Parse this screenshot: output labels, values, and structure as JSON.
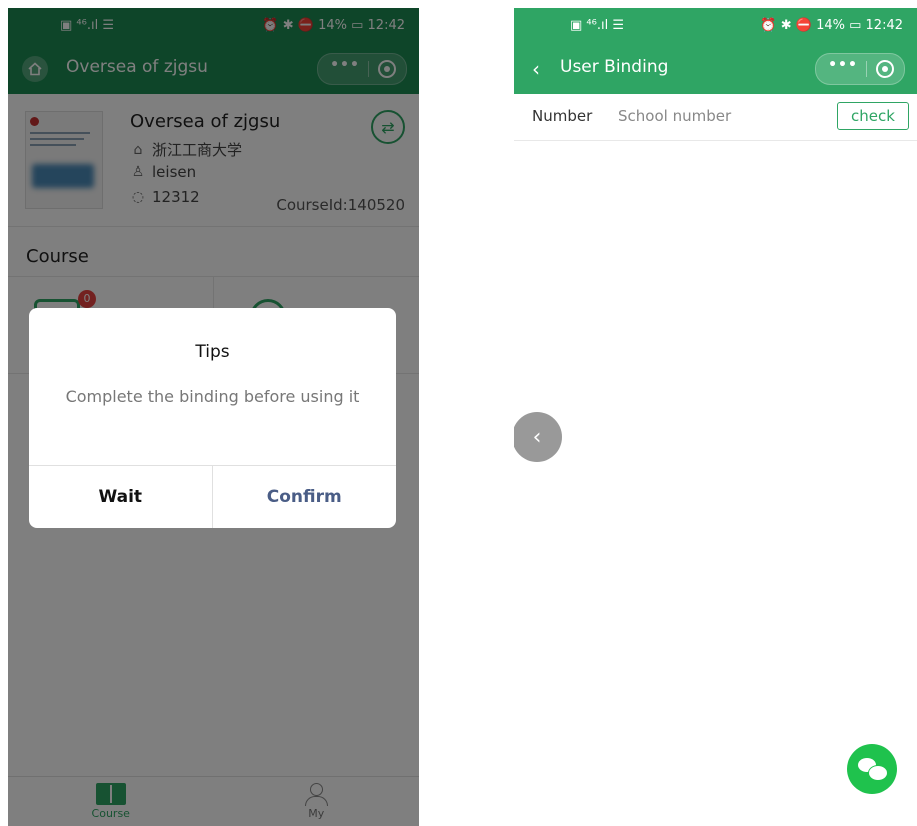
{
  "left": {
    "status": {
      "left": "▣ ⁴⁶.ıl ☰",
      "right": "⏰ ✱ ⛔ 14% ▭ 12:42"
    },
    "nav": {
      "title": "Oversea of zjgsu",
      "menu_dots": "•••"
    },
    "course_card": {
      "title": "Oversea of zjgsu",
      "school": "浙江工商大学",
      "teacher": "leisen",
      "number": "12312",
      "course_id": "CourseId:140520",
      "switch_glyph": "⇄"
    },
    "section_title": "Course",
    "grid": {
      "badge": "0"
    },
    "dialog": {
      "title": "Tips",
      "message": "Complete the binding before using it",
      "cancel_label": "Wait",
      "confirm_label": "Confirm"
    },
    "tabs": [
      {
        "label": "Course",
        "active": true
      },
      {
        "label": "My",
        "active": false
      }
    ]
  },
  "right": {
    "status": {
      "left": "▣ ⁴⁶.ıl ☰",
      "right": "⏰ ✱ ⛔ 14% ▭ 12:42"
    },
    "nav": {
      "title": "User Binding",
      "back": "‹",
      "menu_dots": "•••"
    },
    "form": {
      "label": "Number",
      "placeholder": "School number",
      "value": "",
      "check_label": "check"
    },
    "side_back": "‹"
  },
  "colors": {
    "primary": "#2fa564",
    "primary_dark": "#1d8a52",
    "badge": "#e64340",
    "confirm_text": "#4a5d86",
    "wechat": "#1fc24d"
  }
}
